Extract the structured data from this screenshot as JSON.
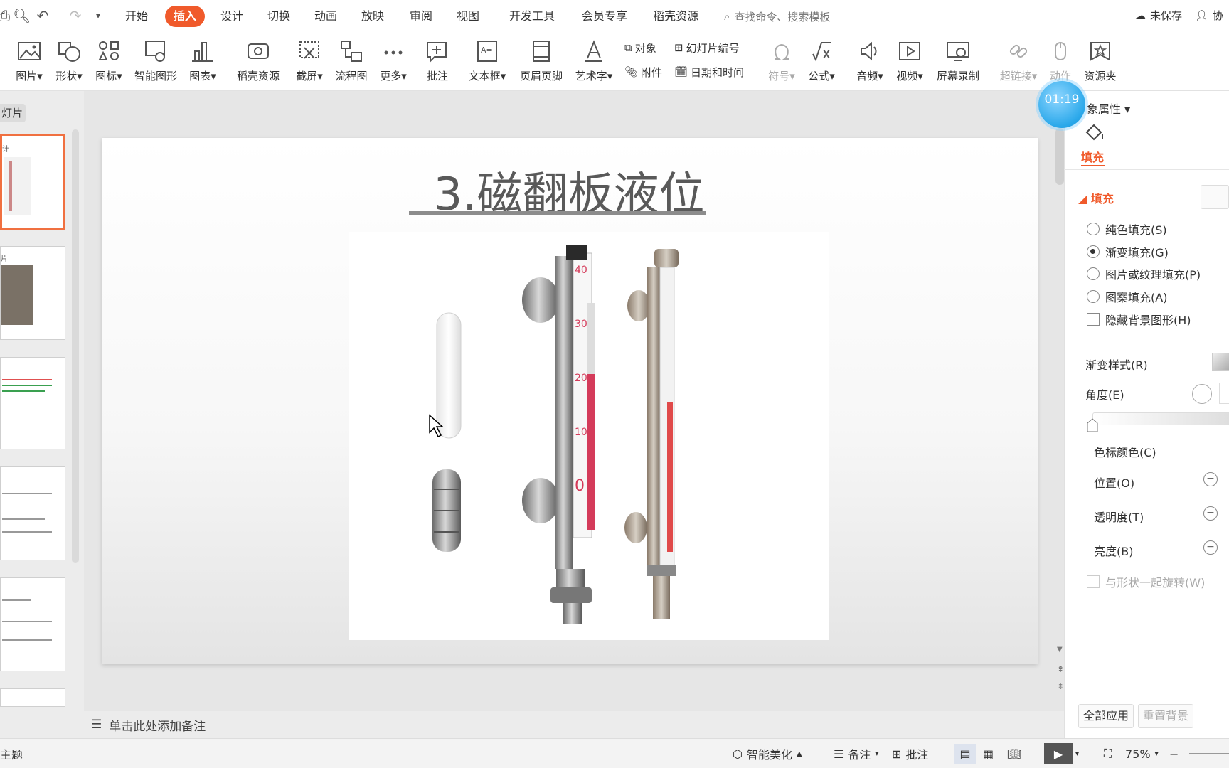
{
  "menubar": {
    "tabs": [
      "开始",
      "插入",
      "设计",
      "切换",
      "动画",
      "放映",
      "审阅",
      "视图",
      "开发工具",
      "会员专享",
      "稻壳资源"
    ],
    "active_tab": "插入",
    "search_placeholder": "查找命令、搜索模板",
    "unsaved": "未保存",
    "collab": "协"
  },
  "ribbon": {
    "picture": "图片",
    "shape": "形状",
    "icon": "图标",
    "smart_graphic": "智能图形",
    "chart": "图表",
    "daoke": "稻壳资源",
    "screenshot": "截屏",
    "flowchart": "流程图",
    "more": "更多",
    "comment": "批注",
    "textbox": "文本框",
    "header_footer": "页眉页脚",
    "wordart": "艺术字",
    "object": "对象",
    "slide_number": "幻灯片编号",
    "attachment": "附件",
    "date_time": "日期和时间",
    "symbol": "符号",
    "formula": "公式",
    "audio": "音频",
    "video": "视频",
    "screen_record": "屏幕录制",
    "hyperlink": "超链接",
    "action": "动作",
    "resource": "资源夹"
  },
  "left_panel": {
    "tab_label": "灯片",
    "thumbs": [
      {
        "caption": "计"
      },
      {
        "caption": "片"
      },
      {
        "caption": ""
      },
      {
        "caption": ""
      },
      {
        "caption": ""
      }
    ]
  },
  "slide": {
    "title": "3.磁翻板液位计",
    "gauge_labels": [
      "40",
      "30",
      "20",
      "10",
      "0"
    ]
  },
  "notes": {
    "placeholder": "单击此处添加备注"
  },
  "status": {
    "theme": "主题",
    "smart_beautify": "智能美化",
    "notes": "备注",
    "comment": "批注",
    "zoom": "75%"
  },
  "right_pane": {
    "timer": "01:19",
    "title": "象属性",
    "fill_tab": "填充",
    "fill_section": "填充",
    "options": [
      {
        "label": "纯色填充(S)",
        "checked": false
      },
      {
        "label": "渐变填充(G)",
        "checked": true
      },
      {
        "label": "图片或纹理填充(P)",
        "checked": false
      },
      {
        "label": "图案填充(A)",
        "checked": false
      }
    ],
    "hide_bg": "隐藏背景图形(H)",
    "gradient_style": "渐变样式(R)",
    "angle": "角度(E)",
    "stop_color": "色标颜色(C)",
    "position": "位置(O)",
    "transparency": "透明度(T)",
    "brightness": "亮度(B)",
    "rotate_with_shape": "与形状一起旋转(W)",
    "apply_all": "全部应用",
    "reset_bg": "重置背景"
  },
  "colors": {
    "accent": "#f05a2b",
    "timer": "#2aa8ea"
  }
}
